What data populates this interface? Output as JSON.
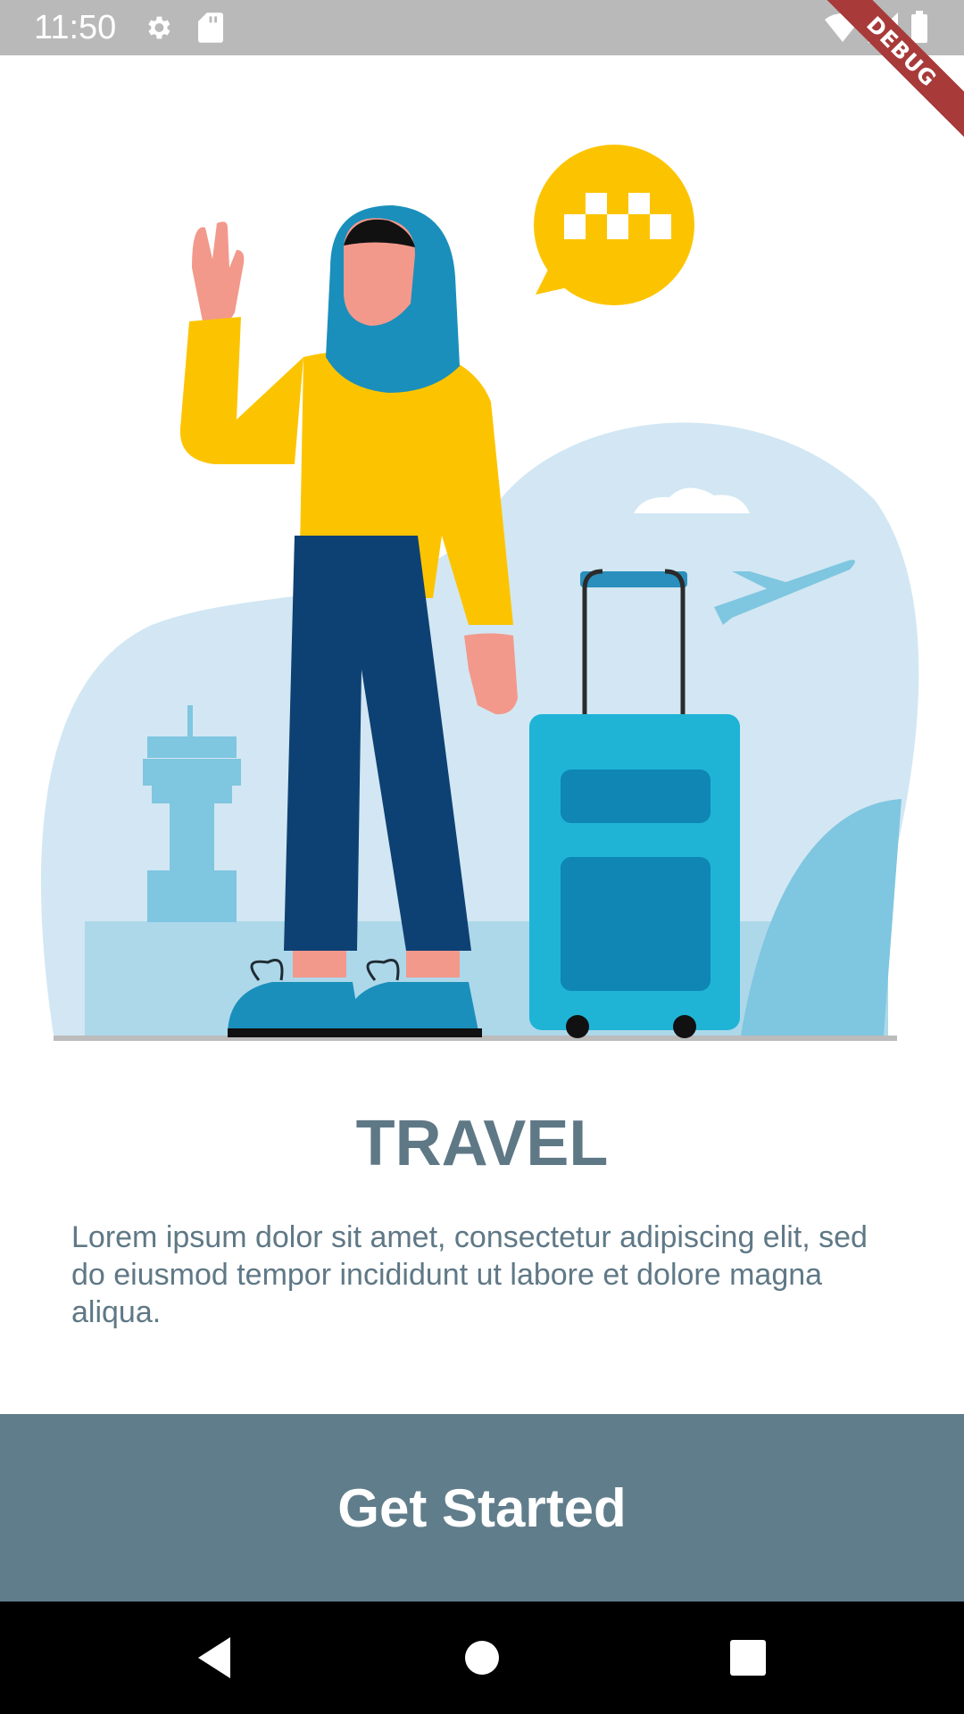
{
  "status_bar": {
    "time": "11:50",
    "icons": [
      "gear-icon",
      "sd-card-icon",
      "wifi-icon",
      "cellular-signal-icon",
      "battery-icon"
    ]
  },
  "debug_banner": {
    "label": "DEBUG"
  },
  "onboarding": {
    "title": "TRAVEL",
    "description": "Lorem ipsum dolor sit amet, consectetur adipiscing elit, sed do eiusmod tempor incididunt ut labore et dolore magna aliqua.",
    "button_label": "Get Started"
  },
  "nav_bar": {
    "buttons": [
      "back-icon",
      "home-icon",
      "recents-icon"
    ]
  },
  "colors": {
    "accent": "#607d8b",
    "text": "#5f7886",
    "status_bar": "#b9b9b9",
    "debug_banner": "#a83a3a"
  }
}
